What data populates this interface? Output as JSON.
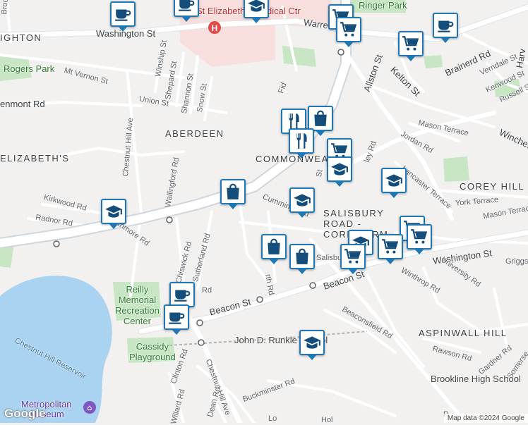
{
  "map": {
    "attribution": "Map data ©2024 Google",
    "logo": "Google",
    "colors": {
      "background": "#f2f1ef",
      "water": "#a9d3f0",
      "park": "#c8e6c3",
      "hospital": "#f9dede",
      "road": "#ffffff",
      "highway_casing": "#cfd6dc",
      "marker_border": "#1f77b4",
      "marker_icon": "#144d7a"
    }
  },
  "labels": {
    "washington_st_west": "Washington St",
    "washington_st_east": "Washington St",
    "warren_st": "Warren St",
    "brock_st": "Brock St",
    "ighton": "IGHTON",
    "rogers_park": "Rogers Park",
    "mt_vernon_st": "Mt Vernon St",
    "enmont_rd": "enmont Rd",
    "winship_st": "Winship St",
    "shepard_st": "Shepard St",
    "shannon_st": "Shannon St",
    "snow_st": "Snow St",
    "union_st": "Union St",
    "chestnut_hill_ave_north": "Chestnut Hill Ave",
    "aberdeen": "ABERDEEN",
    "elizabeths": "ELIZABETH'S",
    "wallingford_rd": "Wallingford Rd",
    "kirkwood_rd": "Kirkwood Rd",
    "radnor_rd": "Radnor Rd",
    "strathmore_rd": "Strathmore Rd",
    "chiswick_rd": "Chiswick Rd",
    "sutherland_rd": "Sutherland Rd",
    "reilly_memorial": "Reilly\nMemorial\nRecreation\nCenter",
    "chestnut_hill_reservoir": "Chestnut Hill Reservoir",
    "cassidy_playground": "Cassidy\nPlayground",
    "beacon_st_west": "Beacon St",
    "beacon_st_east": "Beacon St",
    "clinton_rd": "Clinton Rd",
    "chestnut_hill_ave_south": "Chestnut Hill Ave",
    "willard_rd": "Willard Rd",
    "dean_rd": "Dean Rd",
    "buckminster_rd": "Buckminster Rd",
    "metropolitan_museum": "Metropolitan\nMuseum",
    "runkle_school": "John D. Runkle School",
    "st_elizabeth": "St Elizabeth's Medical Ctr",
    "ringer_park": "Ringer Park",
    "commonwealth": "COMMONWEALTH",
    "cummings_rd": "Cummings Rd",
    "salisbury_road": "SALISBURY\nROAD - \nCORE...ERM",
    "salisbury_rd": "Salisbury Rd",
    "washington_st_right": "Washington St",
    "allston_st": "Allston St",
    "kelton_st": "Kelton St",
    "brainerd_rd": "Brainerd Rd",
    "harvard": "Harv",
    "verndale_st": "Verndale St",
    "kenwood_st": "Kenwood St",
    "russell_st": "Russell St",
    "mason_terrace_top": "Mason Terrace",
    "jordan_rd": "Jordan Rd",
    "winches": "Winches",
    "corey_hill": "COREY HILL",
    "lancaster_terrace": "Lancaster Terrace",
    "york_terrace": "York Terrace",
    "mason_terrace_bottom": "Mason Terrace",
    "griggs": "Griggs",
    "university_rd": "University Rd",
    "winthrop_rd": "Winthrop Rd",
    "aspinwall_hill": "ASPINWALL HILL",
    "beaconsfield_rd": "Beaconsfield Rd",
    "rawson_rd": "Rawson Rd",
    "gardner_rd": "Gardner Rd",
    "somerset": "Somerse",
    "brookline_high": "Brookline High School",
    "pleasant_partial": "P",
    "harvard_partial": "Hol",
    "lond": "Lo",
    "fid": "Fid",
    "st_short": "St",
    "rd_short": "Rd",
    "ley_rd": "ley Rd",
    "rth_rd": "rth Rd"
  },
  "markers": [
    {
      "icon": "coffee-icon",
      "type": "cafe"
    },
    {
      "icon": "coffee-icon",
      "type": "cafe"
    },
    {
      "icon": "graduation-cap-icon",
      "type": "school"
    },
    {
      "icon": "shopping-cart-icon",
      "type": "grocery"
    },
    {
      "icon": "shopping-cart-icon",
      "type": "grocery"
    },
    {
      "icon": "shopping-cart-icon",
      "type": "grocery"
    },
    {
      "icon": "coffee-icon",
      "type": "cafe"
    },
    {
      "icon": "restaurant-icon",
      "type": "restaurant"
    },
    {
      "icon": "shopping-bag-icon",
      "type": "shopping"
    },
    {
      "icon": "restaurant-icon",
      "type": "restaurant"
    },
    {
      "icon": "shopping-cart-icon",
      "type": "grocery"
    },
    {
      "icon": "graduation-cap-icon",
      "type": "school"
    },
    {
      "icon": "graduation-cap-icon",
      "type": "school"
    },
    {
      "icon": "shopping-bag-icon",
      "type": "shopping"
    },
    {
      "icon": "graduation-cap-icon",
      "type": "school"
    },
    {
      "icon": "graduation-cap-icon",
      "type": "school"
    },
    {
      "icon": "shopping-bag-icon",
      "type": "shopping"
    },
    {
      "icon": "shopping-bag-icon",
      "type": "shopping"
    },
    {
      "icon": "graduation-cap-icon",
      "type": "school"
    },
    {
      "icon": "shopping-cart-icon",
      "type": "grocery"
    },
    {
      "icon": "shopping-cart-icon",
      "type": "grocery"
    },
    {
      "icon": "shopping-cart-icon",
      "type": "grocery"
    },
    {
      "icon": "shopping-cart-icon",
      "type": "grocery"
    },
    {
      "icon": "coffee-icon",
      "type": "cafe"
    },
    {
      "icon": "coffee-icon",
      "type": "cafe"
    },
    {
      "icon": "graduation-cap-icon",
      "type": "school"
    }
  ]
}
